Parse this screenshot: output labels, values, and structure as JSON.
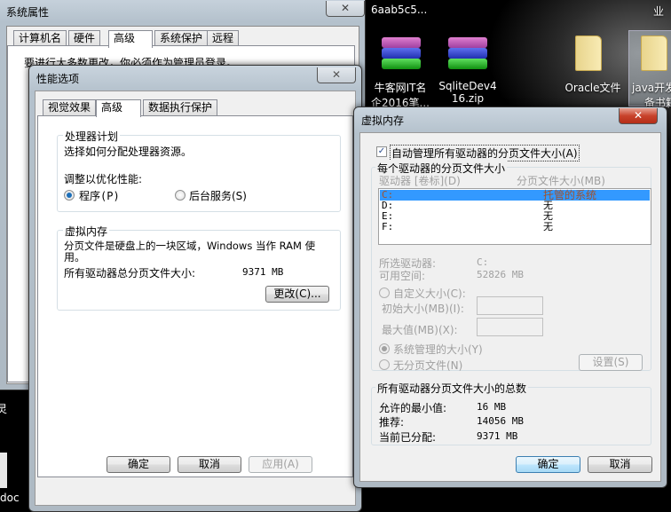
{
  "desktop": {
    "icons": [
      {
        "label": "6aab5c5..."
      },
      {
        "label_line1": "牛客网IT名",
        "label_line2": "企2016笔..."
      },
      {
        "label_line1": "SqliteDev4",
        "label_line2": "16.zip"
      },
      {
        "label": "Oracle文件"
      },
      {
        "label_line1": "java开发",
        "label_line2": "备书籍"
      },
      {
        "label": "业"
      },
      {
        "label": "灵"
      },
      {
        "label": "doc"
      }
    ]
  },
  "system_properties": {
    "title": "系统属性",
    "close": "✕",
    "tabs": [
      "计算机名",
      "硬件",
      "高级",
      "系统保护",
      "远程"
    ],
    "active_tab": "高级",
    "notice": "要进行大多数更改，你必须作为管理员登录。"
  },
  "performance_options": {
    "title": "性能选项",
    "close": "✕",
    "tabs": [
      "视觉效果",
      "高级",
      "数据执行保护"
    ],
    "active_tab": "高级",
    "processor": {
      "title": "处理器计划",
      "desc": "选择如何分配处理器资源。",
      "adjust_label": "调整以优化性能:",
      "option_programs": "程序(P)",
      "option_services": "后台服务(S)",
      "selected": "程序(P)"
    },
    "virtual_memory": {
      "title": "虚拟内存",
      "desc_line1": "分页文件是硬盘上的一块区域，Windows 当作 RAM 使",
      "desc_line2": "用。",
      "total_label": "所有驱动器总分页文件大小:",
      "total_value": "9371 MB",
      "change_button": "更改(C)..."
    },
    "buttons": {
      "ok": "确定",
      "cancel": "取消",
      "apply": "应用(A)"
    }
  },
  "virtual_memory_dialog": {
    "title": "虚拟内存",
    "close": "✕",
    "auto_manage_label": "自动管理所有驱动器的分页文件大小(A)",
    "auto_manage_checked": true,
    "per_drive": {
      "title": "每个驱动器的分页文件大小",
      "col_drive": "驱动器 [卷标](D)",
      "col_size": "分页文件大小(MB)",
      "rows": [
        {
          "drive": "C:",
          "size": "托管的系统",
          "selected": true
        },
        {
          "drive": "D:",
          "size": "无"
        },
        {
          "drive": "E:",
          "size": "无"
        },
        {
          "drive": "F:",
          "size": "无"
        }
      ],
      "selected_drive_label": "所选驱动器:",
      "selected_drive_value": "C:",
      "free_space_label": "可用空间:",
      "free_space_value": "52826 MB",
      "custom_size": "自定义大小(C):",
      "initial_size": "初始大小(MB)(I):",
      "max_size": "最大值(MB)(X):",
      "system_managed": "系统管理的大小(Y)",
      "no_paging": "无分页文件(N)",
      "set_button": "设置(S)"
    },
    "totals": {
      "title": "所有驱动器分页文件大小的总数",
      "min_label": "允许的最小值:",
      "min_value": "16 MB",
      "recommended_label": "推荐:",
      "recommended_value": "14056 MB",
      "allocated_label": "当前已分配:",
      "allocated_value": "9371 MB"
    },
    "buttons": {
      "ok": "确定",
      "cancel": "取消"
    }
  }
}
